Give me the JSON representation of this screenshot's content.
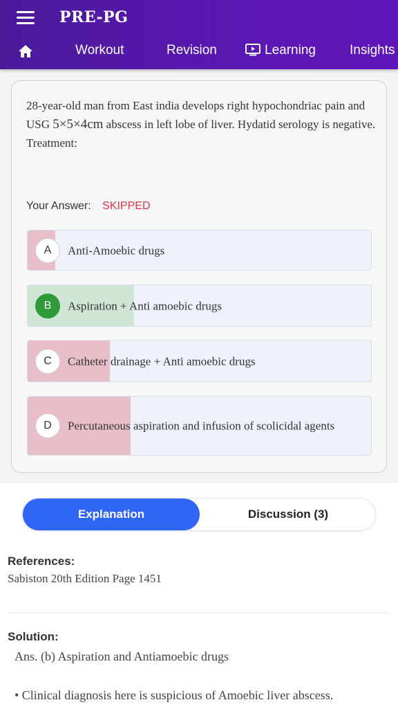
{
  "header": {
    "app_title": "PRE-PG",
    "nav": {
      "workout": "Workout",
      "revision": "Revision",
      "learning": "Learning",
      "insights": "Insights"
    }
  },
  "question": {
    "text_before": "28-year-old man from East india develops right hypochondriac pain and USG ",
    "math": "5×5×4cm",
    "text_after": " abscess in left lobe of liver. Hydatid serology is negative. Treatment:",
    "your_answer_label": "Your Answer:",
    "your_answer_value": "SKIPPED",
    "options": [
      {
        "letter": "A",
        "text": "Anti-Amoebic drugs",
        "percent": 8
      },
      {
        "letter": "B",
        "text": "Aspiration + Anti amoebic drugs",
        "percent": 31,
        "correct": true
      },
      {
        "letter": "C",
        "text": "Catheter drainage + Anti amoebic drugs",
        "percent": 24
      },
      {
        "letter": "D",
        "text": "Percutaneous aspiration and infusion of scolicidal agents",
        "percent": 30
      }
    ]
  },
  "tabs": {
    "explanation": "Explanation",
    "discussion": "Discussion (3)"
  },
  "explanation": {
    "references_heading": "References:",
    "references_text": "Sabiston 20th Edition Page 1451",
    "solution_heading": "Solution:",
    "solution_answer": "Ans. (b) Aspiration and Antiamoebic drugs",
    "solution_bullet": "• Clinical diagnosis here is suspicious of Amoebic liver abscess."
  },
  "colors": {
    "header": "#5b17b3",
    "accent_blue": "#2f66f6",
    "skipped_red": "#e0334a",
    "correct_green": "#2e9a3a",
    "wrong_fill": "#e8bfc8",
    "correct_fill": "#cfe6d6"
  }
}
